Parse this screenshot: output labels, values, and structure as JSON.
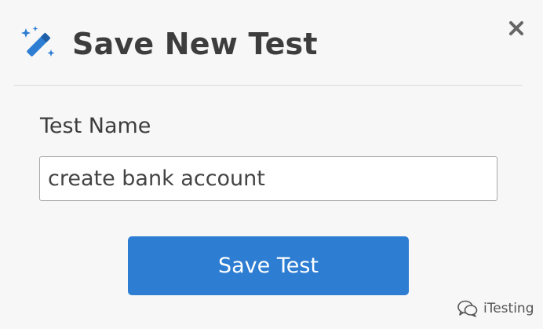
{
  "dialog": {
    "title": "Save New Test",
    "title_icon": "magic-wand-icon",
    "close_icon": "close-icon",
    "field_label": "Test Name",
    "input_value": "create bank account",
    "save_button_label": "Save Test"
  },
  "watermark": {
    "text": "iTesting",
    "icon": "wechat-icon"
  },
  "colors": {
    "accent": "#2d7dd2",
    "title_text": "#3d3d3d",
    "background": "#f7f7f7"
  }
}
